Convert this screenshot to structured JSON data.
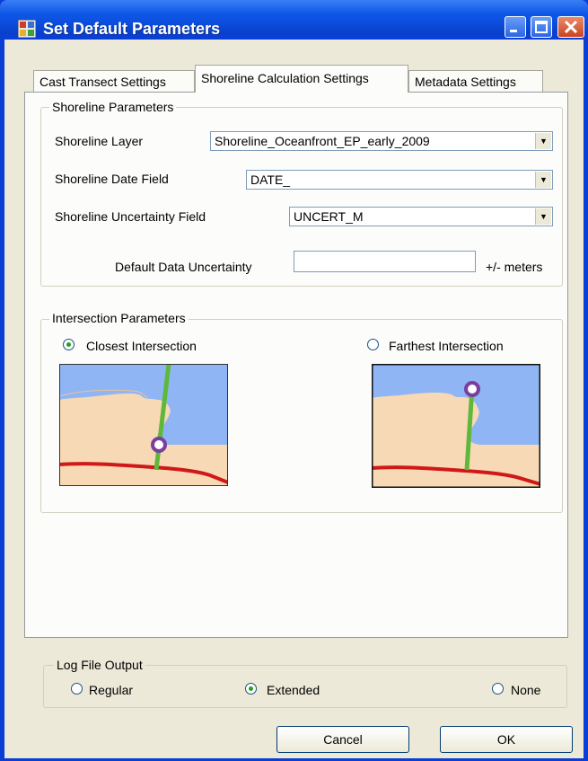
{
  "window": {
    "title": "Set Default Parameters",
    "title_icon": "app-icon",
    "controls": [
      "minimize-icon",
      "maximize-icon",
      "close-icon"
    ]
  },
  "tabs": [
    {
      "label": "Cast Transect Settings",
      "active": false
    },
    {
      "label": "Shoreline Calculation Settings",
      "active": true
    },
    {
      "label": "Metadata Settings",
      "active": false
    }
  ],
  "shoreline_params": {
    "legend": "Shoreline Parameters",
    "layer_label": "Shoreline Layer",
    "layer_value": "Shoreline_Oceanfront_EP_early_2009",
    "date_label": "Shoreline Date Field",
    "date_value": "DATE_",
    "uncert_label": "Shoreline Uncertainty Field",
    "uncert_value": "UNCERT_M",
    "default_uncert_label": "Default Data Uncertainty",
    "default_uncert_value": "",
    "units": "+/- meters"
  },
  "intersection_params": {
    "legend": "Intersection Parameters",
    "closest_label": "Closest Intersection",
    "closest_selected": true,
    "farthest_label": "Farthest Intersection",
    "farthest_selected": false
  },
  "log_output": {
    "legend": "Log File Output",
    "regular_label": "Regular",
    "extended_label": "Extended",
    "none_label": "None",
    "selected": "Extended"
  },
  "buttons": {
    "cancel": "Cancel",
    "ok": "OK"
  },
  "colors": {
    "titlebar": "#0a48d6",
    "dialog_bg": "#ece9d8",
    "water": "#8fb5f5",
    "sand": "#f7d9b5",
    "shoreline_red": "#d01818",
    "transect_green": "#5fb83a",
    "intersection_purple": "#7b3d9e"
  }
}
